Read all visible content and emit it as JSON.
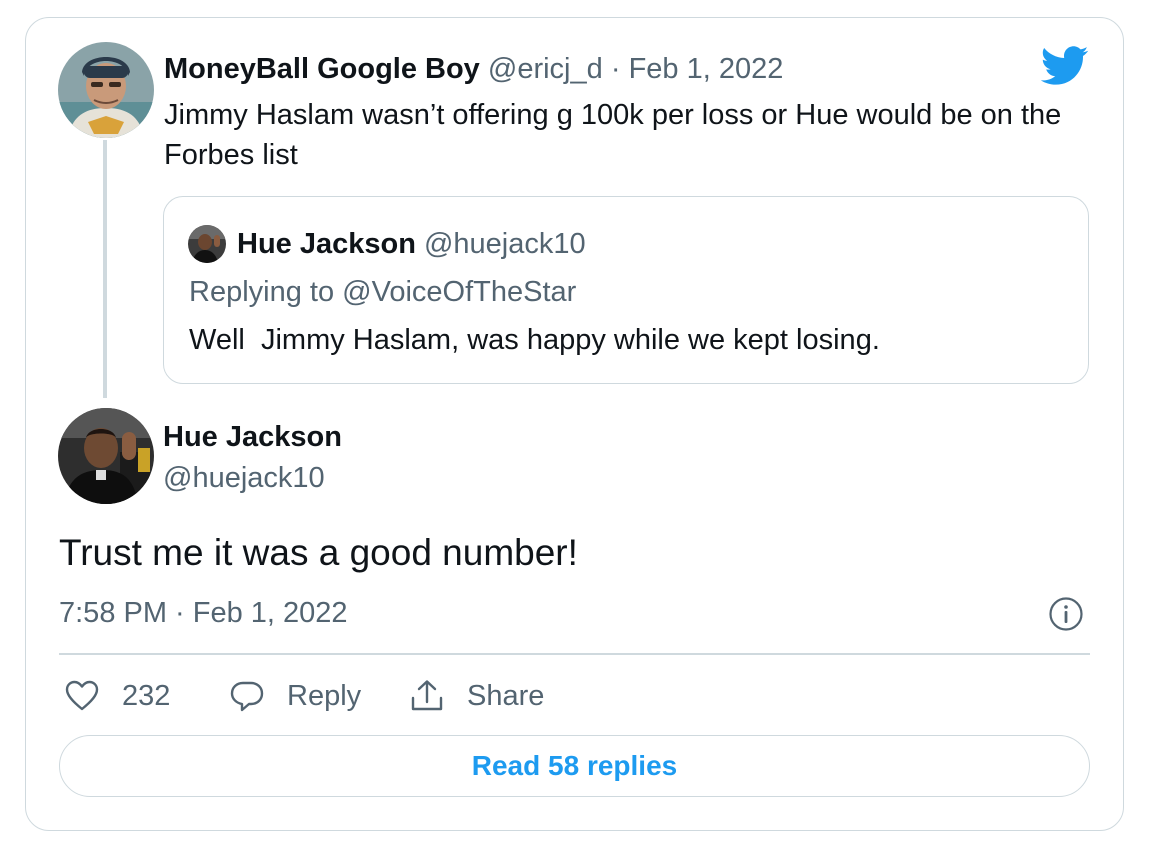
{
  "parent_tweet": {
    "display_name": "MoneyBall Google Boy",
    "handle": "@ericj_d",
    "separator": "·",
    "date": "Feb 1, 2022",
    "text": "Jimmy Haslam wasn’t offering g 100k per loss or Hue would be on the Forbes list"
  },
  "quoted_tweet": {
    "display_name": "Hue Jackson",
    "handle": "@huejack10",
    "replying_to": "Replying to @VoiceOfTheStar",
    "text": "Well  Jimmy Haslam, was happy while we kept losing."
  },
  "main_tweet": {
    "display_name": "Hue Jackson",
    "handle": "@huejack10",
    "text": "Trust me it was a good number!",
    "timestamp": "7:58 PM · Feb 1, 2022"
  },
  "actions": {
    "like_count": "232",
    "reply_label": "Reply",
    "share_label": "Share"
  },
  "read_replies_label": "Read 58 replies",
  "icons": {
    "brand": "twitter-bird-icon",
    "info": "info-icon",
    "like": "heart-icon",
    "reply": "speech-bubble-icon",
    "share": "share-upload-icon"
  },
  "colors": {
    "brand_blue": "#1d9bf0",
    "muted_text": "#536471",
    "border": "#cfd9de",
    "text": "#0f1419"
  }
}
